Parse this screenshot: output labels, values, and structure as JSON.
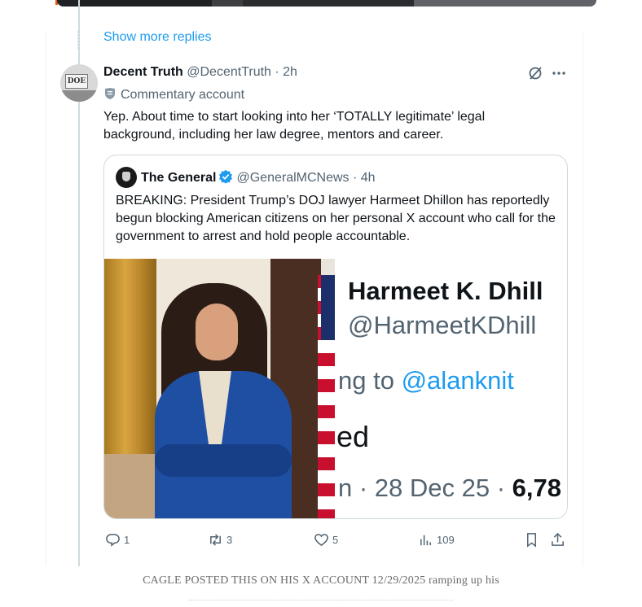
{
  "thread": {
    "show_more": "Show more replies"
  },
  "reply": {
    "display_name": "Decent Truth",
    "handle_time": "@DecentTruth · 2h",
    "account_label": "Commentary account",
    "text": "Yep. About time to start looking into her ‘TOTALLY legitimate’ legal background, including her law degree, mentors and career.",
    "avatar_sign": "DOE"
  },
  "quote": {
    "display_name": "The General",
    "handle_time": "@GeneralMCNews · 4h",
    "text": "BREAKING: President Trump’s DOJ lawyer Harmeet Dhillon has reportedly begun blocking American citizens on her personal X account who call for the government to arrest and hold people accountable.",
    "screenshot": {
      "name": "Harmeet K. Dhill",
      "handle": "@HarmeetKDhill",
      "reply_prefix": "ng to ",
      "reply_mention": "@alanknit",
      "line": "ed",
      "date": "n · 28 Dec 25 · ",
      "views": "6,78"
    }
  },
  "actions": {
    "replies": "1",
    "reposts": "3",
    "likes": "5",
    "views": "109"
  },
  "caption": "CAGLE POSTED THIS ON HIS X ACCOUNT 12/29/2025 ramping up his",
  "colors": {
    "link": "#1d9bf0",
    "secondary_text": "#536471",
    "border": "#cfd9de"
  }
}
